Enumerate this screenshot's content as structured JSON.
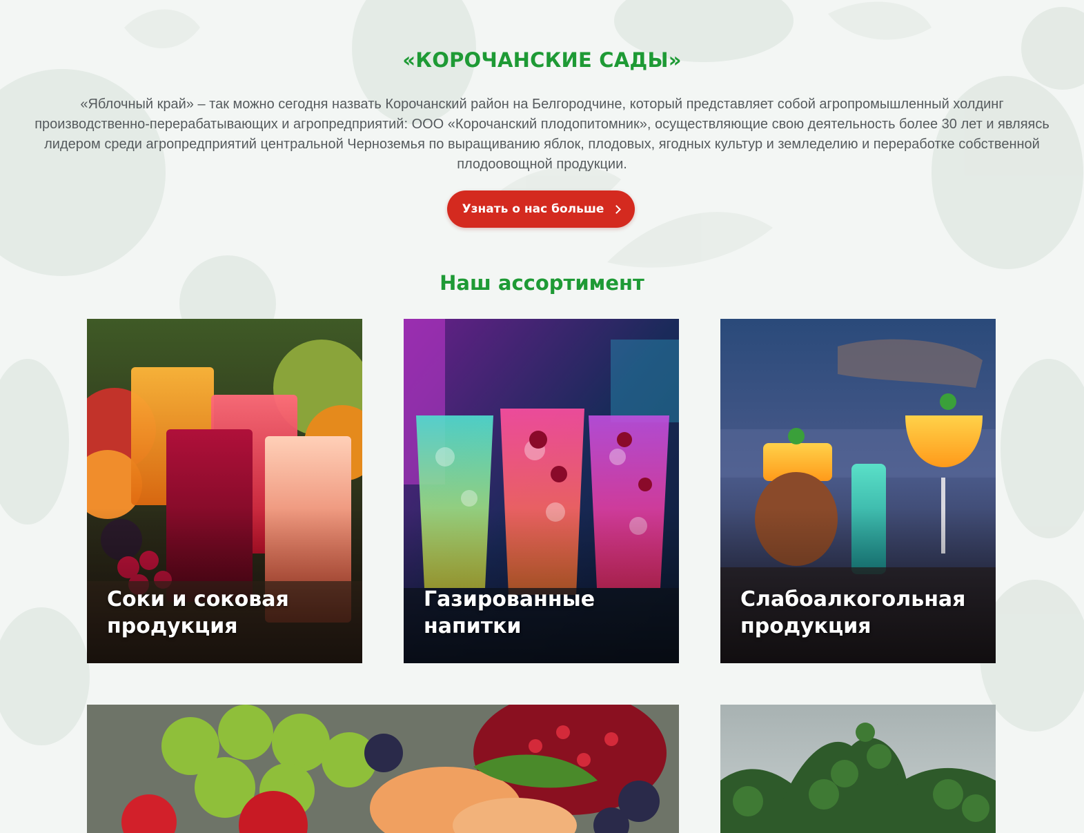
{
  "hero": {
    "title": "«КОРОЧАНСКИЕ САДЫ»",
    "description": "«Яблочный край» – так можно сегодня назвать Корочанский район на Белгородчине, который представляет собой агропромышленный холдинг производственно-перерабатывающих и агропредприятий: ООО «Корочанский плодопитомник», осуществляющие свою деятельность более 30 лет и являясь лидером среди агропредприятий центральной Черноземья по выращиванию яблок, плодовых, ягодных культур и земледелию и переработке собственной плодоовощной продукции.",
    "cta_label": "Узнать о нас больше",
    "cta_icon": "chevron-right-icon"
  },
  "assortment": {
    "title": "Наш ассортимент",
    "cards": [
      {
        "label": "Соки и соковая продукция",
        "image": "juice-glasses-photo"
      },
      {
        "label": "Газированные напитки",
        "image": "carbonated-drinks-photo"
      },
      {
        "label": "Слабоалкогольная продукция",
        "image": "cocktails-photo"
      },
      {
        "label": "",
        "image": "fruits-photo"
      },
      {
        "label": "",
        "image": "orchard-trees-photo"
      }
    ]
  },
  "colors": {
    "accent_green": "#1e9a35",
    "cta_red": "#d42a1f",
    "text_gray": "#555a5d",
    "background": "#f3f6f4"
  }
}
